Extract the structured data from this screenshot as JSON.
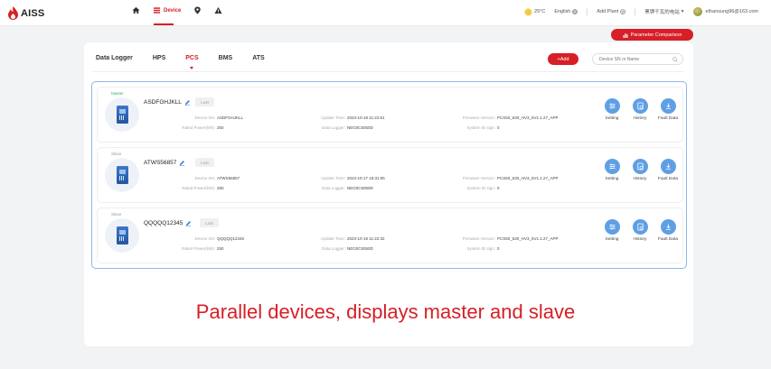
{
  "app": {
    "logo_text": "AISS"
  },
  "nav": [
    {
      "label": ""
    },
    {
      "label": "Device"
    },
    {
      "label": ""
    },
    {
      "label": ""
    }
  ],
  "header": {
    "temperature": "25°C",
    "language": "English",
    "add_plant": "Add Plant",
    "station": "黑钾千瓦的电站",
    "user_email": "ethansung96@163.com"
  },
  "toolbar": {
    "param_comparison": "Parameter Comparison",
    "add_label": "+Add"
  },
  "search": {
    "placeholder": "Device SN or Name"
  },
  "tabs": [
    {
      "label": "Data Logger",
      "active": false
    },
    {
      "label": "HPS",
      "active": false
    },
    {
      "label": "PCS",
      "active": true
    },
    {
      "label": "BMS",
      "active": false
    },
    {
      "label": "ATS",
      "active": false
    }
  ],
  "labels": {
    "device_sn": "Device SN:",
    "rated_power": "Rated Power(kW):",
    "update_time": "Update Time:",
    "data_logger": "Data Logger:",
    "firmware": "Firmware Version:",
    "system_id": "System ID sign:"
  },
  "actions": {
    "setting": "Setting",
    "history": "History",
    "fault": "Fault Data"
  },
  "devices": [
    {
      "role": "Master",
      "name": "ASDFGHJKLL",
      "status": "Lost",
      "sn": "ASDFGHJKLL",
      "rated_power": "250",
      "update_time": "2023-10-18 11:22:51",
      "data_logger": "NEG0C5050D",
      "firmware": "PCS50_630_HV3_5V1.1.27_APP",
      "system_id": "0"
    },
    {
      "role": "Slave",
      "name": "ATWS56857",
      "status": "Lost",
      "sn": "ATWS56857",
      "rated_power": "250",
      "update_time": "2023-10-17 16:31:05",
      "data_logger": "NEG0C5050D",
      "firmware": "PCS50_630_HV3_5V1.1.27_APP",
      "system_id": "0"
    },
    {
      "role": "Slave",
      "name": "QQQQQ12345",
      "status": "Lost",
      "sn": "QQQQQ12345",
      "rated_power": "250",
      "update_time": "2023-10-18 11:22:32",
      "data_logger": "NEG0C5050D",
      "firmware": "PCS50_630_HV3_5V1.1.27_APP",
      "system_id": "0"
    }
  ],
  "caption": "Parallel devices, displays master and slave",
  "colors": {
    "brand": "#d61f26",
    "action_blue": "#5f9fe6",
    "master_green": "#37b26b"
  }
}
